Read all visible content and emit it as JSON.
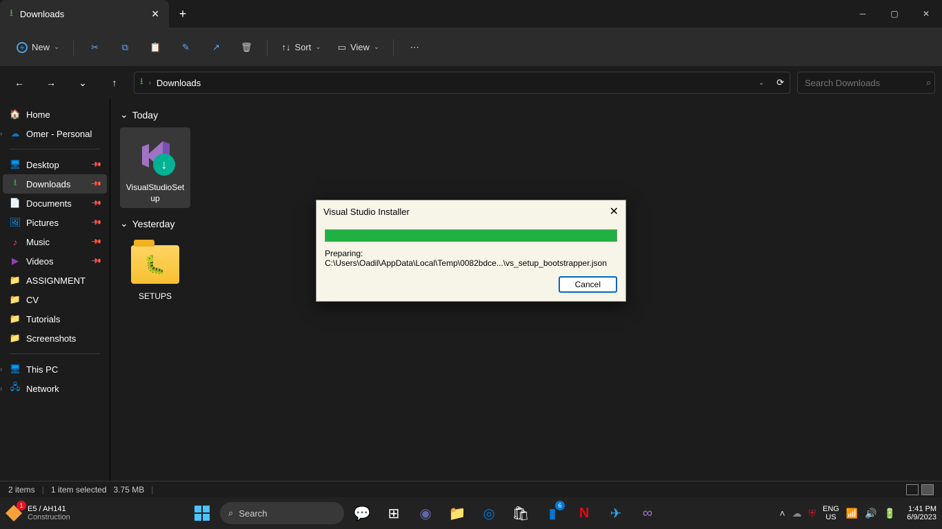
{
  "titlebar": {
    "tab_title": "Downloads"
  },
  "toolbar": {
    "new": "New",
    "sort": "Sort",
    "view": "View"
  },
  "address": {
    "crumb": "Downloads",
    "search_placeholder": "Search Downloads"
  },
  "sidebar": {
    "home": "Home",
    "personal": "Omer - Personal",
    "desktop": "Desktop",
    "downloads": "Downloads",
    "documents": "Documents",
    "pictures": "Pictures",
    "music": "Music",
    "videos": "Videos",
    "assignment": "ASSIGNMENT",
    "cv": "CV",
    "tutorials": "Tutorials",
    "screenshots": "Screenshots",
    "thispc": "This PC",
    "network": "Network"
  },
  "content": {
    "group_today": "Today",
    "group_yesterday": "Yesterday",
    "file_vs": "VisualStudioSetup",
    "file_setups": "SETUPS"
  },
  "status": {
    "items": "2 items",
    "selected": "1 item selected",
    "size": "3.75 MB"
  },
  "dialog": {
    "title": "Visual Studio Installer",
    "text": "Preparing: C:\\Users\\Oadil\\AppData\\Local\\Temp\\0082bdce...\\vs_setup_bootstrapper.json",
    "cancel": "Cancel"
  },
  "taskbar": {
    "weather_line1": "E5 / AH141",
    "weather_line2": "Construction",
    "weather_badge": "1",
    "search": "Search",
    "lang1": "ENG",
    "lang2": "US",
    "time": "1:41 PM",
    "date": "6/9/2023",
    "badge6": "6"
  }
}
